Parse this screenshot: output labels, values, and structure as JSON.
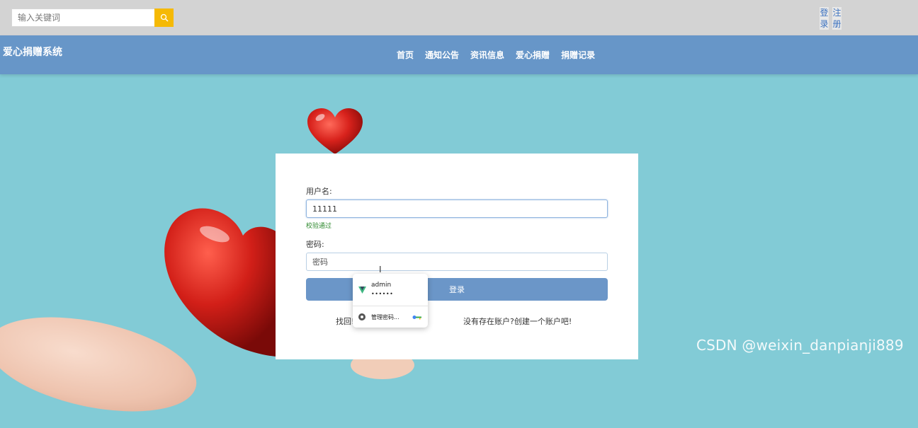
{
  "topbar": {
    "search_placeholder": "输入关键词",
    "search_icon": "search-icon",
    "login_link": "登录",
    "register_link": "注册"
  },
  "navbar": {
    "site_title": "爱心捐赠系统",
    "menu": [
      {
        "label": "首页"
      },
      {
        "label": "通知公告"
      },
      {
        "label": "资讯信息"
      },
      {
        "label": "爱心捐赠"
      },
      {
        "label": "捐赠记录"
      }
    ]
  },
  "login_form": {
    "username_label": "用户名:",
    "username_value": "11111",
    "validation_message": "校验通过",
    "password_label": "密码:",
    "password_placeholder": "密码",
    "submit_label": "登录",
    "forgot_link": "找回密码",
    "forgot_link_visible": "找回!",
    "register_prompt": "没有存在账户?创建一个账户吧!"
  },
  "autofill_popup": {
    "account_name": "admin",
    "masked_password": "••••••",
    "manage_label": "管理密码...",
    "app_icon": "vue-logo-icon",
    "chrome_icon": "chrome-icon",
    "key_icon": "key-icon"
  },
  "watermark": "CSDN @weixin_danpianji889",
  "colors": {
    "background": "#82cbd6",
    "topbar": "#d3d3d3",
    "navbar": "#6796c8",
    "search_button": "#f5b905",
    "login_button": "#6b96c8",
    "heart": "#d8221c",
    "valid_text": "#2f8a2f"
  }
}
